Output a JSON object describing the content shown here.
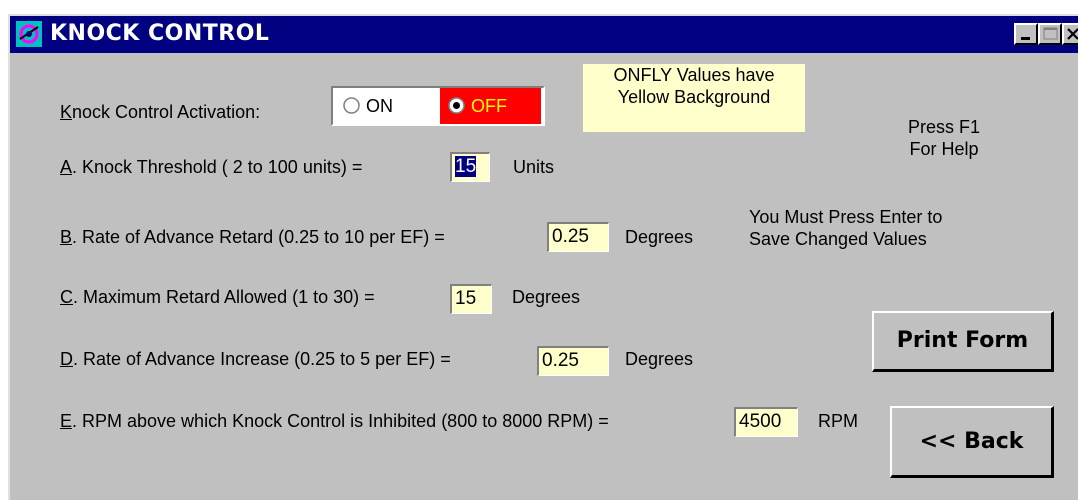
{
  "window": {
    "title": "KNOCK CONTROL",
    "minimize_icon": "minimize-icon",
    "restore_icon": "restore-icon",
    "close_icon": "close-icon"
  },
  "activation": {
    "label_key": "K",
    "label_rest": "nock Control Activation:",
    "on_label": "ON",
    "off_label": "OFF",
    "selected": "OFF"
  },
  "note": {
    "line1": "ONFLY Values have",
    "line2": "Yellow Background"
  },
  "help": {
    "line1": "Press F1",
    "line2": "For Help"
  },
  "enter_note": {
    "line1": "You Must Press Enter to",
    "line2": "Save Changed Values"
  },
  "fields": [
    {
      "key": "A",
      "label": ". Knock Threshold ( 2 to 100 units)  =",
      "value": "15",
      "unit": "Units"
    },
    {
      "key": "B",
      "label": ". Rate of Advance Retard (0.25 to 10 per EF) =",
      "value": "0.25",
      "unit": "Degrees"
    },
    {
      "key": "C",
      "label": ". Maximum Retard Allowed (1 to 30) =",
      "value": "15",
      "unit": "Degrees"
    },
    {
      "key": "D",
      "label": ". Rate of Advance Increase (0.25 to 5 per EF) =",
      "value": "0.25",
      "unit": "Degrees"
    },
    {
      "key": "E",
      "label": ". RPM above which Knock Control is Inhibited (800 to 8000 RPM) =",
      "value": "4500",
      "unit": "RPM"
    }
  ],
  "buttons": {
    "print": "Print Form",
    "back": "<< Back"
  }
}
